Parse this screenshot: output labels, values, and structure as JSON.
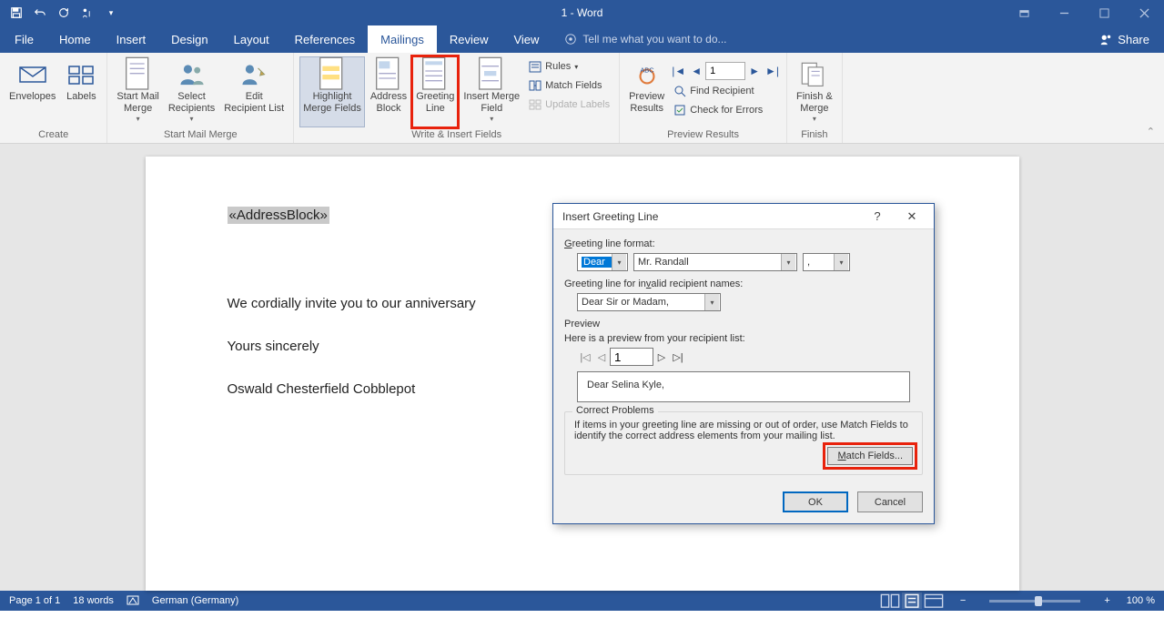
{
  "title": "1 - Word",
  "tabs": {
    "file": "File",
    "home": "Home",
    "insert": "Insert",
    "design": "Design",
    "layout": "Layout",
    "references": "References",
    "mailings": "Mailings",
    "review": "Review",
    "view": "View"
  },
  "tellme": "Tell me what you want to do...",
  "share": "Share",
  "ribbon": {
    "create": {
      "label": "Create",
      "envelopes": "Envelopes",
      "labels": "Labels"
    },
    "start": {
      "label": "Start Mail Merge",
      "start": "Start Mail\nMerge",
      "select": "Select\nRecipients",
      "edit": "Edit\nRecipient List"
    },
    "write": {
      "label": "Write & Insert Fields",
      "highlight": "Highlight\nMerge Fields",
      "address": "Address\nBlock",
      "greeting": "Greeting\nLine",
      "insertfield": "Insert Merge\nField",
      "rules": "Rules",
      "match": "Match Fields",
      "update": "Update Labels"
    },
    "preview": {
      "label": "Preview Results",
      "btn": "Preview\nResults",
      "record": "1",
      "find": "Find Recipient",
      "check": "Check for Errors"
    },
    "finish": {
      "label": "Finish",
      "btn": "Finish &\nMerge"
    }
  },
  "document": {
    "addressblock": "«AddressBlock»",
    "body": "We cordially invite you to our anniversary",
    "closing": "Yours sincerely",
    "signature": "Oswald Chesterfield Cobblepot"
  },
  "dialog": {
    "title": "Insert Greeting Line",
    "format_lbl": "Greeting line format:",
    "salutation": "Dear",
    "name": "Mr. Randall",
    "punct": ",",
    "invalid_lbl": "Greeting line for invalid recipient names:",
    "invalid_val": "Dear Sir or Madam,",
    "preview_lbl": "Preview",
    "preview_desc": "Here is a preview from your recipient list:",
    "preview_idx": "1",
    "preview_text": "Dear Selina Kyle,",
    "correct_lbl": "Correct Problems",
    "correct_desc": "If items in your greeting line are missing or out of order, use Match Fields to identify the correct address elements from your mailing list.",
    "match_btn": "Match Fields...",
    "ok": "OK",
    "cancel": "Cancel"
  },
  "status": {
    "page": "Page 1 of 1",
    "words": "18 words",
    "lang": "German (Germany)",
    "zoom": "100 %"
  }
}
